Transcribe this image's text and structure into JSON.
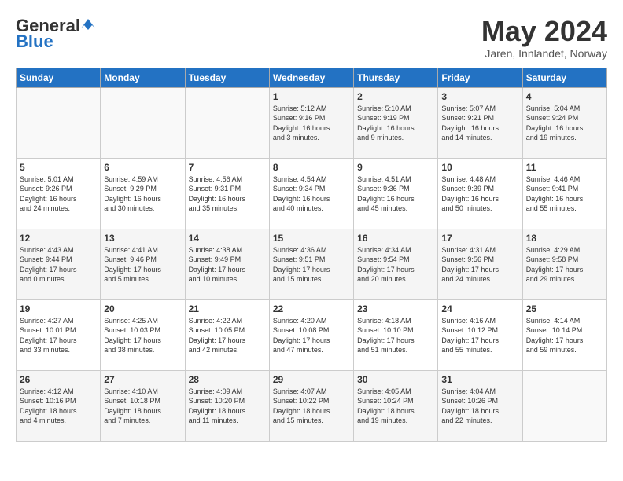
{
  "header": {
    "logo_general": "General",
    "logo_blue": "Blue",
    "month_title": "May 2024",
    "location": "Jaren, Innlandet, Norway"
  },
  "weekdays": [
    "Sunday",
    "Monday",
    "Tuesday",
    "Wednesday",
    "Thursday",
    "Friday",
    "Saturday"
  ],
  "weeks": [
    [
      {
        "day": "",
        "info": ""
      },
      {
        "day": "",
        "info": ""
      },
      {
        "day": "",
        "info": ""
      },
      {
        "day": "1",
        "info": "Sunrise: 5:12 AM\nSunset: 9:16 PM\nDaylight: 16 hours\nand 3 minutes."
      },
      {
        "day": "2",
        "info": "Sunrise: 5:10 AM\nSunset: 9:19 PM\nDaylight: 16 hours\nand 9 minutes."
      },
      {
        "day": "3",
        "info": "Sunrise: 5:07 AM\nSunset: 9:21 PM\nDaylight: 16 hours\nand 14 minutes."
      },
      {
        "day": "4",
        "info": "Sunrise: 5:04 AM\nSunset: 9:24 PM\nDaylight: 16 hours\nand 19 minutes."
      }
    ],
    [
      {
        "day": "5",
        "info": "Sunrise: 5:01 AM\nSunset: 9:26 PM\nDaylight: 16 hours\nand 24 minutes."
      },
      {
        "day": "6",
        "info": "Sunrise: 4:59 AM\nSunset: 9:29 PM\nDaylight: 16 hours\nand 30 minutes."
      },
      {
        "day": "7",
        "info": "Sunrise: 4:56 AM\nSunset: 9:31 PM\nDaylight: 16 hours\nand 35 minutes."
      },
      {
        "day": "8",
        "info": "Sunrise: 4:54 AM\nSunset: 9:34 PM\nDaylight: 16 hours\nand 40 minutes."
      },
      {
        "day": "9",
        "info": "Sunrise: 4:51 AM\nSunset: 9:36 PM\nDaylight: 16 hours\nand 45 minutes."
      },
      {
        "day": "10",
        "info": "Sunrise: 4:48 AM\nSunset: 9:39 PM\nDaylight: 16 hours\nand 50 minutes."
      },
      {
        "day": "11",
        "info": "Sunrise: 4:46 AM\nSunset: 9:41 PM\nDaylight: 16 hours\nand 55 minutes."
      }
    ],
    [
      {
        "day": "12",
        "info": "Sunrise: 4:43 AM\nSunset: 9:44 PM\nDaylight: 17 hours\nand 0 minutes."
      },
      {
        "day": "13",
        "info": "Sunrise: 4:41 AM\nSunset: 9:46 PM\nDaylight: 17 hours\nand 5 minutes."
      },
      {
        "day": "14",
        "info": "Sunrise: 4:38 AM\nSunset: 9:49 PM\nDaylight: 17 hours\nand 10 minutes."
      },
      {
        "day": "15",
        "info": "Sunrise: 4:36 AM\nSunset: 9:51 PM\nDaylight: 17 hours\nand 15 minutes."
      },
      {
        "day": "16",
        "info": "Sunrise: 4:34 AM\nSunset: 9:54 PM\nDaylight: 17 hours\nand 20 minutes."
      },
      {
        "day": "17",
        "info": "Sunrise: 4:31 AM\nSunset: 9:56 PM\nDaylight: 17 hours\nand 24 minutes."
      },
      {
        "day": "18",
        "info": "Sunrise: 4:29 AM\nSunset: 9:58 PM\nDaylight: 17 hours\nand 29 minutes."
      }
    ],
    [
      {
        "day": "19",
        "info": "Sunrise: 4:27 AM\nSunset: 10:01 PM\nDaylight: 17 hours\nand 33 minutes."
      },
      {
        "day": "20",
        "info": "Sunrise: 4:25 AM\nSunset: 10:03 PM\nDaylight: 17 hours\nand 38 minutes."
      },
      {
        "day": "21",
        "info": "Sunrise: 4:22 AM\nSunset: 10:05 PM\nDaylight: 17 hours\nand 42 minutes."
      },
      {
        "day": "22",
        "info": "Sunrise: 4:20 AM\nSunset: 10:08 PM\nDaylight: 17 hours\nand 47 minutes."
      },
      {
        "day": "23",
        "info": "Sunrise: 4:18 AM\nSunset: 10:10 PM\nDaylight: 17 hours\nand 51 minutes."
      },
      {
        "day": "24",
        "info": "Sunrise: 4:16 AM\nSunset: 10:12 PM\nDaylight: 17 hours\nand 55 minutes."
      },
      {
        "day": "25",
        "info": "Sunrise: 4:14 AM\nSunset: 10:14 PM\nDaylight: 17 hours\nand 59 minutes."
      }
    ],
    [
      {
        "day": "26",
        "info": "Sunrise: 4:12 AM\nSunset: 10:16 PM\nDaylight: 18 hours\nand 4 minutes."
      },
      {
        "day": "27",
        "info": "Sunrise: 4:10 AM\nSunset: 10:18 PM\nDaylight: 18 hours\nand 7 minutes."
      },
      {
        "day": "28",
        "info": "Sunrise: 4:09 AM\nSunset: 10:20 PM\nDaylight: 18 hours\nand 11 minutes."
      },
      {
        "day": "29",
        "info": "Sunrise: 4:07 AM\nSunset: 10:22 PM\nDaylight: 18 hours\nand 15 minutes."
      },
      {
        "day": "30",
        "info": "Sunrise: 4:05 AM\nSunset: 10:24 PM\nDaylight: 18 hours\nand 19 minutes."
      },
      {
        "day": "31",
        "info": "Sunrise: 4:04 AM\nSunset: 10:26 PM\nDaylight: 18 hours\nand 22 minutes."
      },
      {
        "day": "",
        "info": ""
      }
    ]
  ]
}
